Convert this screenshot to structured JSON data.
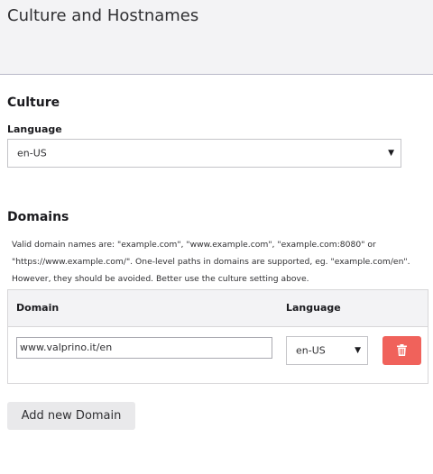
{
  "header": {
    "title": "Culture and Hostnames"
  },
  "culture": {
    "section_title": "Culture",
    "language_label": "Language",
    "language_value": "en-US"
  },
  "domains": {
    "section_title": "Domains",
    "help_lines": [
      "Valid domain names are: \"example.com\", \"www.example.com\", \"example.com:8080\" or",
      "\"https://www.example.com/\". One-level paths in domains are supported, eg. \"example.com/en\".",
      "However, they should be avoided. Better use the culture setting above."
    ],
    "columns": {
      "domain": "Domain",
      "language": "Language"
    },
    "rows": [
      {
        "domain": "www.valprino.it/en",
        "language": "en-US"
      }
    ],
    "add_button": "Add new Domain"
  },
  "colors": {
    "delete_button": "#f0625b",
    "header_bg": "#f3f3f5"
  },
  "icons": {
    "delete": "trash-icon",
    "dropdown": "caret-down-icon"
  }
}
